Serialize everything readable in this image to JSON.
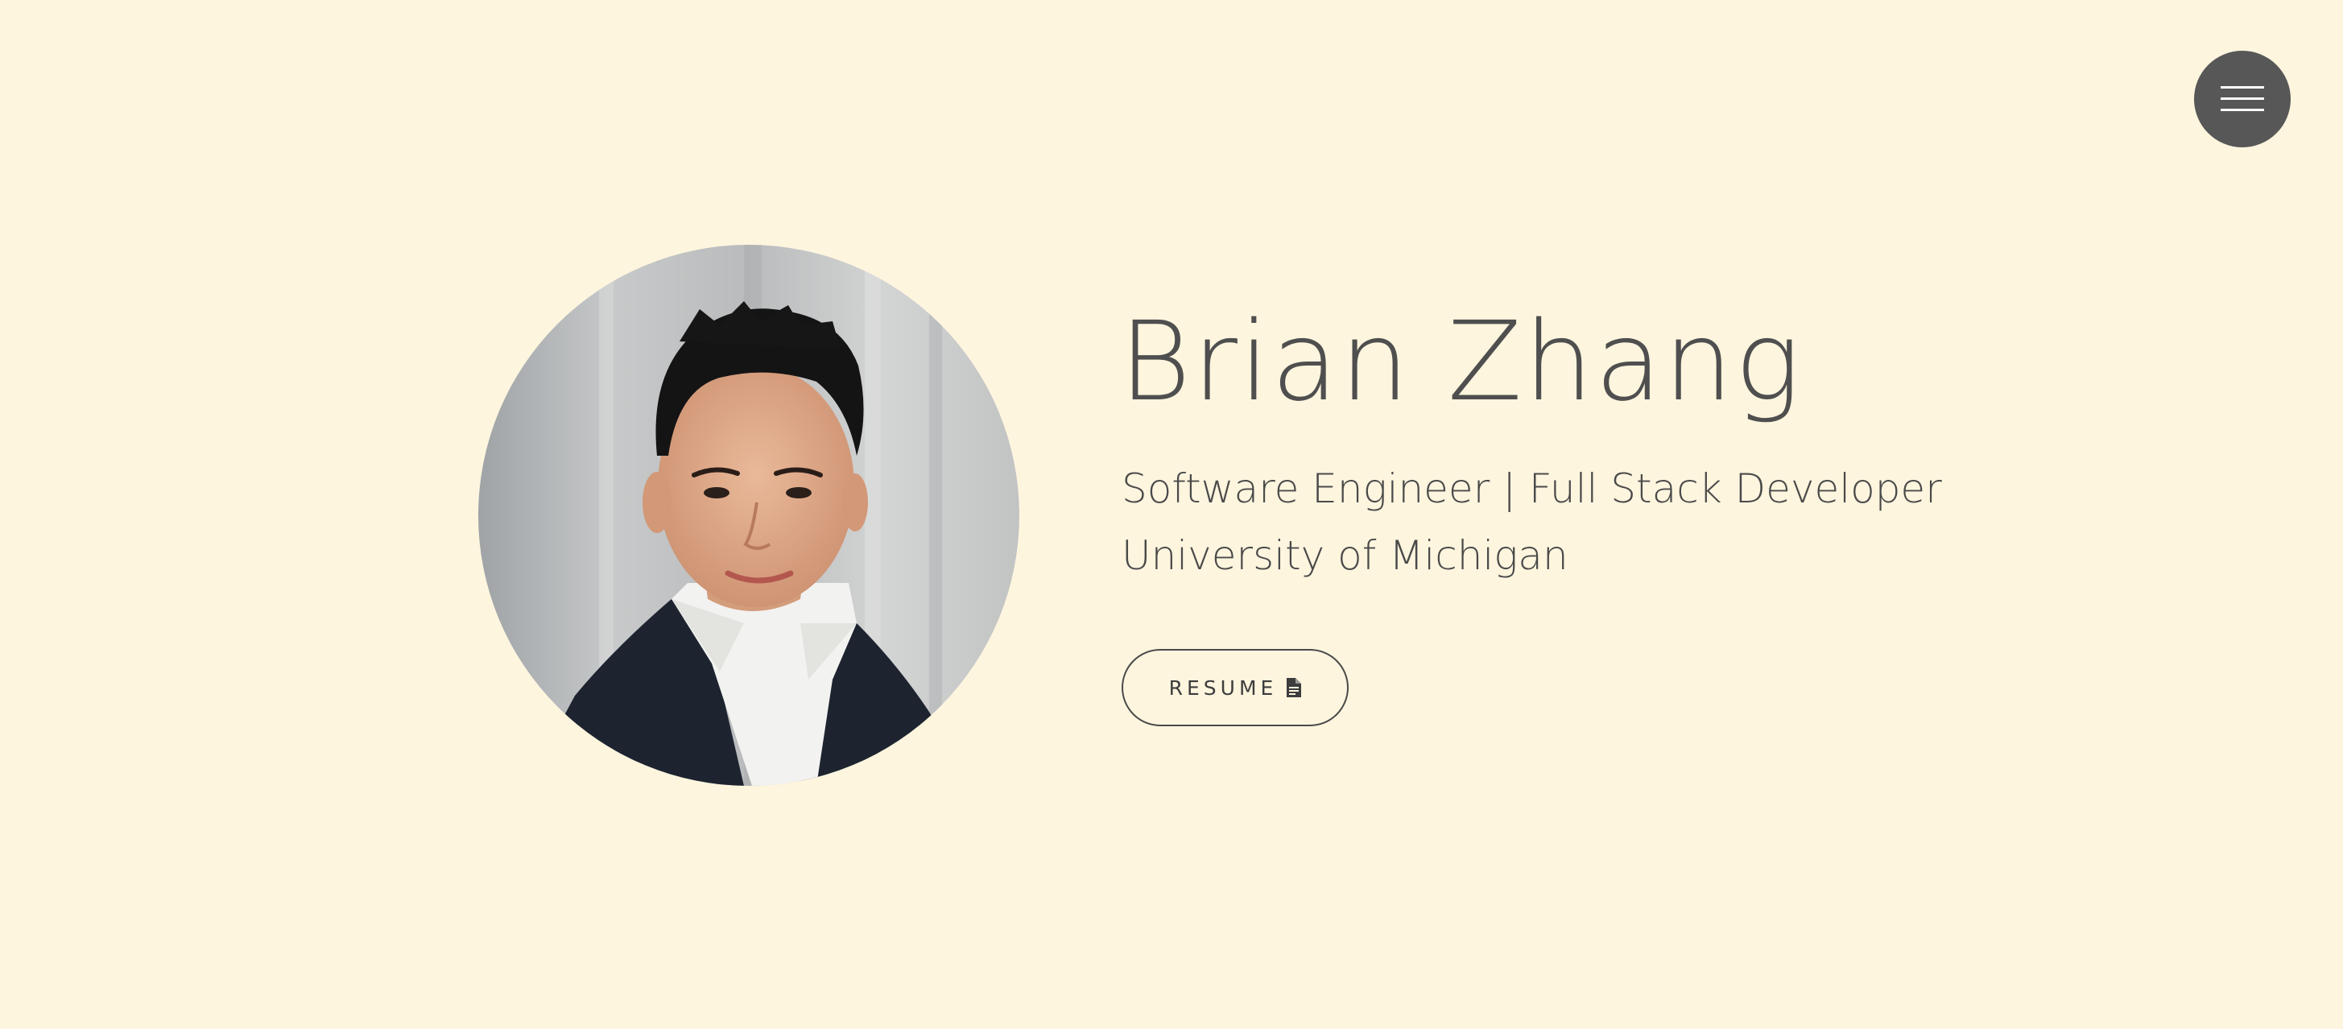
{
  "nav": {
    "menu_icon": "hamburger-icon"
  },
  "profile": {
    "name": "Brian Zhang",
    "role": "Software Engineer | Full Stack Developer",
    "school": "University of Michigan",
    "resume_label": "RESUME",
    "resume_icon": "file-icon"
  },
  "colors": {
    "background": "#fdf5de",
    "text": "#4a4a4a",
    "menu_button": "#575757"
  }
}
